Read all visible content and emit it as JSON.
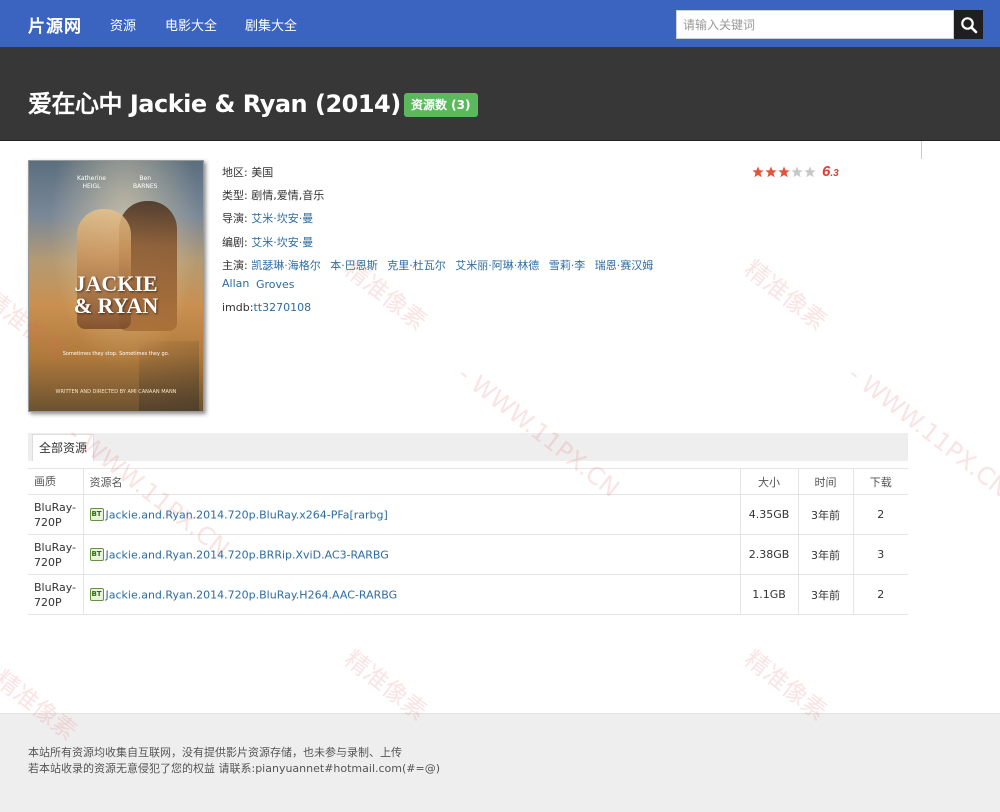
{
  "nav": {
    "logo": "片源网",
    "links": [
      "资源",
      "电影大全",
      "剧集大全"
    ],
    "search_placeholder": "请输入关键词"
  },
  "movie": {
    "title": "爱在心中 Jackie & Ryan (2014)",
    "resource_count_label": "资源数 (3)",
    "region_label": "地区:",
    "region": "美国",
    "genre_label": "类型:",
    "genre": "剧情,爱情,音乐",
    "director_label": "导演:",
    "director": "艾米·坎安·曼",
    "writer_label": "编剧:",
    "writer": "艾米·坎安·曼",
    "cast_label": "主演:",
    "cast": [
      "凯瑟琳·海格尔",
      "本·巴恩斯",
      "克里·杜瓦尔",
      "艾米丽·阿琳·林德",
      "雪莉·李",
      "瑞恩·赛汉姆",
      "Allan",
      "Groves"
    ],
    "imdb_label": "imdb:",
    "imdb": "tt3270108",
    "rating": {
      "stars": 3,
      "max": 5,
      "score_int": "6",
      "score_dec": ".3"
    },
    "poster": {
      "title_line1": "JACKIE",
      "title_line2": "& RYAN",
      "actor1": "Katherine\nHEIGL",
      "actor2": "Ben\nBARNES",
      "tagline": "Sometimes they stop. Sometimes they go.",
      "credit": "WRITTEN AND DIRECTED BY AMI CANAAN MANN"
    }
  },
  "resources": {
    "tab_label": "全部资源",
    "headers": {
      "quality": "画质",
      "name": "资源名",
      "size": "大小",
      "time": "时间",
      "downloads": "下载"
    },
    "rows": [
      {
        "quality": "BluRay-720P",
        "name": "Jackie.and.Ryan.2014.720p.BluRay.x264-PFa[rarbg]",
        "size": "4.35GB",
        "time": "3年前",
        "downloads": "2"
      },
      {
        "quality": "BluRay-720P",
        "name": "Jackie.and.Ryan.2014.720p.BRRip.XviD.AC3-RARBG",
        "size": "2.38GB",
        "time": "3年前",
        "downloads": "3"
      },
      {
        "quality": "BluRay-720P",
        "name": "Jackie.and.Ryan.2014.720p.BluRay.H264.AAC-RARBG",
        "size": "1.1GB",
        "time": "3年前",
        "downloads": "2"
      }
    ],
    "bt_icon": "BT"
  },
  "footer": {
    "line1": "本站所有资源均收集自互联网，没有提供影片资源存储，也未参与录制、上传",
    "line2": "若本站收录的资源无意侵犯了您的权益 请联系:pianyuannet#hotmail.com(#=@)"
  },
  "colors": {
    "nav_bg": "#3a64c0",
    "title_band_bg": "#373737",
    "badge_green": "#5cb85c",
    "link_blue": "#2d6ca2",
    "rating_red": "#e53935"
  },
  "watermark": {
    "text1": "精准像素",
    "text2": "- WWW.11PX.CN"
  }
}
